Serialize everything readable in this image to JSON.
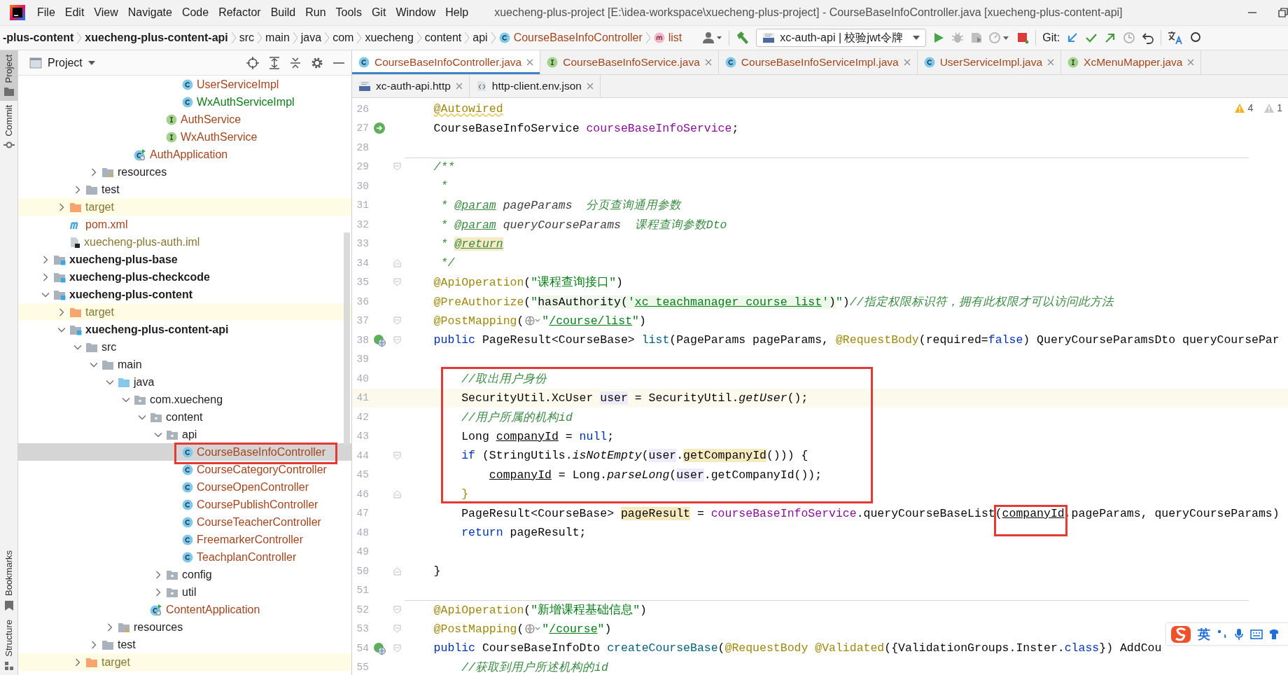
{
  "title_bar": {
    "menu": [
      "File",
      "Edit",
      "View",
      "Navigate",
      "Code",
      "Refactor",
      "Build",
      "Run",
      "Tools",
      "Git",
      "Window",
      "Help"
    ],
    "title": "xuecheng-plus-project [E:\\idea-workspace\\xuecheng-plus-project] - CourseBaseInfoController.java [xuecheng-plus-content-api]"
  },
  "navigation_bar": {
    "breadcrumbs": [
      {
        "label": "-plus-content",
        "kind": "module"
      },
      {
        "label": "xuecheng-plus-content-api",
        "kind": "module"
      },
      {
        "label": "src",
        "kind": "folder"
      },
      {
        "label": "main",
        "kind": "folder"
      },
      {
        "label": "java",
        "kind": "folder"
      },
      {
        "label": "com",
        "kind": "folder"
      },
      {
        "label": "xuecheng",
        "kind": "folder"
      },
      {
        "label": "content",
        "kind": "folder"
      },
      {
        "label": "api",
        "kind": "folder"
      },
      {
        "label": "CourseBaseInfoController",
        "kind": "class"
      },
      {
        "label": "list",
        "kind": "method"
      }
    ],
    "run_configuration": "xc-auth-api | 校验jwt令牌",
    "git_label": "Git:"
  },
  "tool_strip": {
    "top": [
      {
        "label": "Project",
        "selected": true
      },
      {
        "label": "Commit",
        "selected": false
      }
    ],
    "bottom": [
      {
        "label": "Bookmarks",
        "selected": false
      },
      {
        "label": "Structure",
        "selected": false
      }
    ]
  },
  "project_panel": {
    "title": "Project",
    "tree": [
      {
        "children": [
          {
            "children": [
              {
                "children": [
                  {
                    "children": [
                      {
                        "children": [
                          {
                            "children": [
                              {
                                "children": [
                                  {
                                    "children": [
                                      {
                                        "label": "UserServiceImpl",
                                        "kind": "class",
                                        "color": "#a3461f",
                                        "selected": false
                                      },
                                      {
                                        "label": "WxAuthServiceImpl",
                                        "kind": "class",
                                        "color": "#0b7d16",
                                        "selected": false
                                      }
                                    ]
                                  },
                                  {
                                    "label": "AuthService",
                                    "kind": "interface",
                                    "color": "#a3461f",
                                    "selected": false
                                  },
                                  {
                                    "label": "WxAuthService",
                                    "kind": "interface",
                                    "color": "#a3461f",
                                    "selected": false
                                  }
                                ]
                              }
                            ]
                          },
                          {
                            "label": "AuthApplication",
                            "kind": "application",
                            "color": "#a3461f",
                            "selected": false
                          }
                        ]
                      }
                    ]
                  },
                  {
                    "label": "resources",
                    "kind": "resources-folder",
                    "expanded": false,
                    "selected": false
                  }
                ]
              },
              {
                "label": "test",
                "kind": "folder",
                "expanded": false,
                "selected": false
              }
            ]
          },
          {
            "label": "target",
            "kind": "excluded-folder",
            "color": "#877732",
            "expanded": false,
            "selected": false
          },
          {
            "label": "pom.xml",
            "kind": "maven-file",
            "color": "#a3461f",
            "selected": false
          },
          {
            "label": "xuecheng-plus-auth.iml",
            "kind": "module-file",
            "color": "#877732",
            "selected": false
          }
        ]
      },
      {
        "label": "xuecheng-plus-base",
        "kind": "module",
        "expanded": false,
        "selected": false
      },
      {
        "label": "xuecheng-plus-checkcode",
        "kind": "module",
        "expanded": false,
        "selected": false
      },
      {
        "label": "xuecheng-plus-content",
        "kind": "module",
        "expanded": true,
        "selected": false,
        "children": [
          {
            "label": "target",
            "kind": "excluded-folder",
            "color": "#877732",
            "expanded": false,
            "selected": false
          },
          {
            "label": "xuecheng-plus-content-api",
            "kind": "module",
            "expanded": true,
            "selected": false,
            "children": [
              {
                "label": "src",
                "kind": "folder",
                "expanded": true,
                "selected": false,
                "children": [
                  {
                    "label": "main",
                    "kind": "folder",
                    "expanded": true,
                    "selected": false,
                    "children": [
                      {
                        "label": "java",
                        "kind": "source-folder",
                        "expanded": true,
                        "selected": false,
                        "children": [
                          {
                            "label": "com.xuecheng",
                            "kind": "package",
                            "expanded": true,
                            "selected": false,
                            "children": [
                              {
                                "label": "content",
                                "kind": "package",
                                "expanded": true,
                                "selected": false,
                                "children": [
                                  {
                                    "label": "api",
                                    "kind": "package",
                                    "expanded": true,
                                    "selected": false,
                                    "children": [
                                      {
                                        "label": "CourseBaseInfoController",
                                        "kind": "class",
                                        "color": "#a3461f",
                                        "selected": true,
                                        "boxed": true
                                      },
                                      {
                                        "label": "CourseCategoryController",
                                        "kind": "class",
                                        "color": "#a3461f",
                                        "selected": false
                                      },
                                      {
                                        "label": "CourseOpenController",
                                        "kind": "class",
                                        "color": "#a3461f",
                                        "selected": false
                                      },
                                      {
                                        "label": "CoursePublishController",
                                        "kind": "class",
                                        "color": "#a3461f",
                                        "selected": false
                                      },
                                      {
                                        "label": "CourseTeacherController",
                                        "kind": "class",
                                        "color": "#a3461f",
                                        "selected": false
                                      },
                                      {
                                        "label": "FreemarkerController",
                                        "kind": "class",
                                        "color": "#a3461f",
                                        "selected": false
                                      },
                                      {
                                        "label": "TeachplanController",
                                        "kind": "class",
                                        "color": "#a3461f",
                                        "selected": false
                                      }
                                    ]
                                  },
                                  {
                                    "label": "config",
                                    "kind": "package",
                                    "expanded": false,
                                    "selected": false
                                  },
                                  {
                                    "label": "util",
                                    "kind": "package",
                                    "expanded": false,
                                    "selected": false
                                  }
                                ]
                              },
                              {
                                "label": "ContentApplication",
                                "kind": "application",
                                "color": "#a3461f",
                                "selected": false
                              }
                            ]
                          }
                        ]
                      },
                      {
                        "label": "resources",
                        "kind": "resources-folder",
                        "expanded": false,
                        "selected": false
                      }
                    ]
                  },
                  {
                    "label": "test",
                    "kind": "folder",
                    "expanded": false,
                    "selected": false
                  }
                ]
              },
              {
                "label": "target",
                "kind": "excluded-folder",
                "color": "#877732",
                "expanded": false,
                "selected": false
              }
            ]
          }
        ]
      }
    ]
  },
  "editor": {
    "tab_rows": [
      [
        {
          "label": "CourseBaseInfoController.java",
          "kind": "class",
          "color": "#a3461f",
          "selected": true
        },
        {
          "label": "CourseBaseInfoService.java",
          "kind": "interface",
          "color": "#a3461f",
          "selected": false
        },
        {
          "label": "CourseBaseInfoServiceImpl.java",
          "kind": "class",
          "color": "#a3461f",
          "selected": false
        },
        {
          "label": "UserServiceImpl.java",
          "kind": "class",
          "color": "#a3461f",
          "selected": false
        },
        {
          "label": "XcMenuMapper.java",
          "kind": "interface",
          "color": "#a3461f",
          "selected": false
        }
      ],
      [
        {
          "label": "xc-auth-api.http",
          "kind": "http",
          "selected": false
        },
        {
          "label": "http-client.env.json",
          "kind": "json",
          "selected": false
        }
      ]
    ],
    "inspections": {
      "warnings": "4",
      "weak_warnings": "1"
    },
    "blocks": [
      {
        "framed": false,
        "lines": [
          {
            "number": "26",
            "segments": [
              {
                "kind": "annotation-warning",
                "text": "    @Autowired"
              }
            ]
          },
          {
            "number": "27",
            "gutter": {
              "kind": "bean"
            },
            "segments": [
              {
                "kind": "plain",
                "text": "    CourseBaseInfoService "
              },
              {
                "kind": "field",
                "text": "courseBaseInfoService"
              },
              {
                "kind": "plain",
                "text": ";"
              }
            ]
          },
          {
            "number": "28"
          },
          {
            "number": "29",
            "fold": {
              "kind": "start"
            },
            "separator_before": true,
            "segments": [
              {
                "kind": "doc",
                "text": "    /**"
              }
            ]
          },
          {
            "number": "30",
            "segments": [
              {
                "kind": "doc",
                "text": "     *"
              }
            ]
          },
          {
            "number": "31",
            "segments": [
              {
                "kind": "doc",
                "text": "     * "
              },
              {
                "kind": "doc-tag",
                "text": "@param"
              },
              {
                "kind": "doc-param",
                "text": " pageParams"
              },
              {
                "kind": "doc",
                "text": "  分页查询通用参数"
              }
            ]
          },
          {
            "number": "32",
            "segments": [
              {
                "kind": "doc",
                "text": "     * "
              },
              {
                "kind": "doc-tag",
                "text": "@param"
              },
              {
                "kind": "doc-param",
                "text": " queryCourseParams"
              },
              {
                "kind": "doc",
                "text": "  课程查询参数Dto"
              }
            ]
          },
          {
            "number": "33",
            "segments": [
              {
                "kind": "doc",
                "text": "     * "
              },
              {
                "kind": "doc-tag-marked",
                "text": "@return"
              }
            ]
          },
          {
            "number": "34",
            "fold": {
              "kind": "end"
            },
            "segments": [
              {
                "kind": "doc",
                "text": "     */"
              }
            ]
          },
          {
            "number": "35",
            "fold": {
              "kind": "start"
            },
            "segments": [
              {
                "kind": "annotation",
                "text": "    @ApiOperation"
              },
              {
                "kind": "plain",
                "text": "("
              },
              {
                "kind": "string",
                "text": "\"课程查询接口\""
              },
              {
                "kind": "plain",
                "text": ")"
              }
            ]
          },
          {
            "number": "36",
            "segments": [
              {
                "kind": "annotation",
                "text": "    @PreAuthorize"
              },
              {
                "kind": "plain",
                "text": "("
              },
              {
                "kind": "string",
                "text": "\""
              },
              {
                "kind": "injected",
                "text": "hasAuthority("
              },
              {
                "kind": "injected-string",
                "text": "'"
              },
              {
                "kind": "injected-link",
                "text": "xc_teachmanager_course_list"
              },
              {
                "kind": "injected-string",
                "text": "'"
              },
              {
                "kind": "injected",
                "text": ")"
              },
              {
                "kind": "string",
                "text": "\""
              },
              {
                "kind": "plain",
                "text": ")"
              },
              {
                "kind": "comment",
                "text": "//指定权限标识符，拥有此权限才可以访问此方法"
              }
            ]
          },
          {
            "number": "37",
            "fold": {
              "kind": "start"
            },
            "segments": [
              {
                "kind": "annotation",
                "text": "    @PostMapping"
              },
              {
                "kind": "plain",
                "text": "("
              },
              {
                "kind": "globe"
              },
              {
                "kind": "string",
                "text": "\""
              },
              {
                "kind": "url",
                "text": "/course/list"
              },
              {
                "kind": "string",
                "text": "\""
              },
              {
                "kind": "plain",
                "text": ")"
              }
            ]
          },
          {
            "number": "38",
            "gutter": {
              "kind": "endpoint"
            },
            "fold": {
              "kind": "start"
            },
            "segments": [
              {
                "kind": "keyword",
                "text": "    public"
              },
              {
                "kind": "plain",
                "text": " PageResult<CourseBase> "
              },
              {
                "kind": "method",
                "text": "list"
              },
              {
                "kind": "plain",
                "text": "(PageParams pageParams, "
              },
              {
                "kind": "annotation",
                "text": "@RequestBody"
              },
              {
                "kind": "plain",
                "text": "(required="
              },
              {
                "kind": "keyword",
                "text": "false"
              },
              {
                "kind": "plain",
                "text": ") QueryCourseParamsDto queryCoursePar"
              }
            ]
          },
          {
            "number": "39"
          }
        ]
      },
      {
        "framed": true,
        "lines": [
          {
            "number": "40",
            "segments": [
              {
                "kind": "comment",
                "text": "        //取出用户身份"
              }
            ]
          },
          {
            "number": "41",
            "current": true,
            "segments": [
              {
                "kind": "plain",
                "text": "        SecurityUtil.XcUser "
              },
              {
                "kind": "variable",
                "text": "user"
              },
              {
                "kind": "plain",
                "text": " = SecurityUtil."
              },
              {
                "kind": "static-call",
                "text": "getUser"
              },
              {
                "kind": "plain",
                "text": "();"
              }
            ]
          },
          {
            "number": "42",
            "segments": [
              {
                "kind": "comment",
                "text": "        //用户所属的机构id"
              }
            ]
          },
          {
            "number": "43",
            "segments": [
              {
                "kind": "plain",
                "text": "        Long "
              },
              {
                "kind": "reassigned",
                "text": "companyId"
              },
              {
                "kind": "plain",
                "text": " = "
              },
              {
                "kind": "keyword",
                "text": "null"
              },
              {
                "kind": "plain",
                "text": ";"
              }
            ]
          },
          {
            "number": "44",
            "fold": {
              "kind": "start"
            },
            "segments": [
              {
                "kind": "keyword",
                "text": "        if"
              },
              {
                "kind": "plain",
                "text": " (StringUtils."
              },
              {
                "kind": "static-call",
                "text": "isNotEmpty"
              },
              {
                "kind": "plain",
                "text": "("
              },
              {
                "kind": "variable",
                "text": "user"
              },
              {
                "kind": "plain",
                "text": "."
              },
              {
                "kind": "usage",
                "text": "getCompanyId"
              },
              {
                "kind": "plain",
                "text": "())) {"
              }
            ]
          },
          {
            "number": "45",
            "segments": [
              {
                "kind": "reassigned",
                "text": "            companyId"
              },
              {
                "kind": "plain",
                "text": " = Long."
              },
              {
                "kind": "static-call",
                "text": "parseLong"
              },
              {
                "kind": "plain",
                "text": "("
              },
              {
                "kind": "variable",
                "text": "user"
              },
              {
                "kind": "plain",
                "text": ".getCompanyId());"
              }
            ]
          },
          {
            "number": "46",
            "fold": {
              "kind": "end"
            },
            "segments": [
              {
                "kind": "brace",
                "text": "        }"
              }
            ]
          }
        ]
      },
      {
        "framed": false,
        "lines": [
          {
            "number": "47",
            "segments": [
              {
                "kind": "plain",
                "text": "        PageResult<CourseBase> "
              },
              {
                "kind": "usage",
                "text": "pageResult"
              },
              {
                "kind": "plain",
                "text": " = "
              },
              {
                "kind": "field",
                "text": "courseBaseInfoService"
              },
              {
                "kind": "plain",
                "text": ".queryCourseBaseList("
              },
              {
                "kind": "reassigned",
                "text": "companyId",
                "boxed": true
              },
              {
                "kind": "plain",
                "text": ",pageParams, queryCourseParams)"
              }
            ]
          },
          {
            "number": "48",
            "segments": [
              {
                "kind": "keyword",
                "text": "        return"
              },
              {
                "kind": "plain",
                "text": " pageResult;"
              }
            ]
          },
          {
            "number": "49"
          },
          {
            "number": "50",
            "fold": {
              "kind": "end"
            },
            "segments": [
              {
                "kind": "plain",
                "text": "    }"
              }
            ]
          },
          {
            "number": "51"
          },
          {
            "number": "52",
            "fold": {
              "kind": "start"
            },
            "separator_before": true,
            "segments": [
              {
                "kind": "annotation",
                "text": "    @ApiOperation"
              },
              {
                "kind": "plain",
                "text": "("
              },
              {
                "kind": "string",
                "text": "\"新增课程基础信息\""
              },
              {
                "kind": "plain",
                "text": ")"
              }
            ]
          },
          {
            "number": "53",
            "fold": {
              "kind": "start"
            },
            "segments": [
              {
                "kind": "annotation",
                "text": "    @PostMapping"
              },
              {
                "kind": "plain",
                "text": "("
              },
              {
                "kind": "globe"
              },
              {
                "kind": "string",
                "text": "\""
              },
              {
                "kind": "url",
                "text": "/course"
              },
              {
                "kind": "string",
                "text": "\""
              },
              {
                "kind": "plain",
                "text": ")"
              }
            ]
          },
          {
            "number": "54",
            "gutter": {
              "kind": "endpoint"
            },
            "fold": {
              "kind": "start"
            },
            "segments": [
              {
                "kind": "keyword",
                "text": "    public"
              },
              {
                "kind": "plain",
                "text": " CourseBaseInfoDto "
              },
              {
                "kind": "method",
                "text": "createCourseBase"
              },
              {
                "kind": "plain",
                "text": "("
              },
              {
                "kind": "annotation",
                "text": "@RequestBody @Validated"
              },
              {
                "kind": "plain",
                "text": "({ValidationGroups.Inster."
              },
              {
                "kind": "keyword",
                "text": "class"
              },
              {
                "kind": "plain",
                "text": "}) AddCou"
              }
            ]
          },
          {
            "number": "55",
            "segments": [
              {
                "kind": "comment",
                "text": "        //获取到用户所述机构的id"
              }
            ]
          }
        ]
      }
    ]
  },
  "input_method_bar": {
    "mode": "英"
  }
}
